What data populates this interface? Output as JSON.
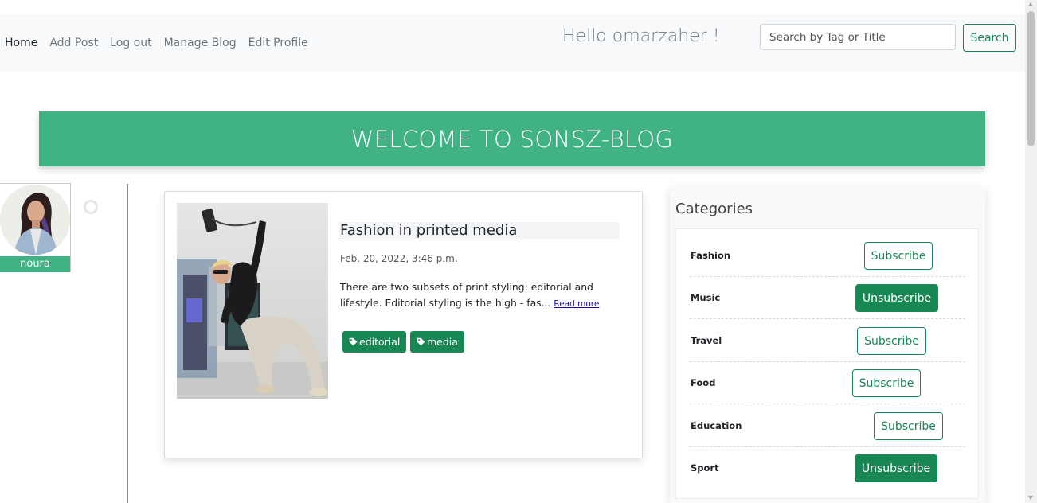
{
  "nav": {
    "links": [
      "Home",
      "Add Post",
      "Log out",
      "Manage Blog",
      "Edit Profile"
    ],
    "greeting": "Hello omarzaher !",
    "search_placeholder": "Search by Tag or Title",
    "search_label": "Search"
  },
  "banner": {
    "title": "WELCOME TO SONSZ-BLOG"
  },
  "user": {
    "name": "noura"
  },
  "post": {
    "title": "Fashion in printed media",
    "date": "Feb. 20, 2022, 3:46 p.m.",
    "excerpt": "There are two subsets of print styling: editorial and lifestyle. Editorial styling is the high - fas...",
    "read_more": "Read more",
    "tags": [
      "editorial",
      "media"
    ]
  },
  "categories": {
    "title": "Categories",
    "items": [
      {
        "name": "Fashion",
        "action": "Subscribe"
      },
      {
        "name": "Music",
        "action": "Unsubscribe"
      },
      {
        "name": "Travel",
        "action": "Subscribe"
      },
      {
        "name": "Food",
        "action": "Subscribe"
      },
      {
        "name": "Education",
        "action": "Subscribe"
      },
      {
        "name": "Sport",
        "action": "Unsubscribe"
      }
    ]
  },
  "colors": {
    "accent": "#41b283",
    "button": "#198754",
    "navbar_bg": "#f8f9fa"
  }
}
